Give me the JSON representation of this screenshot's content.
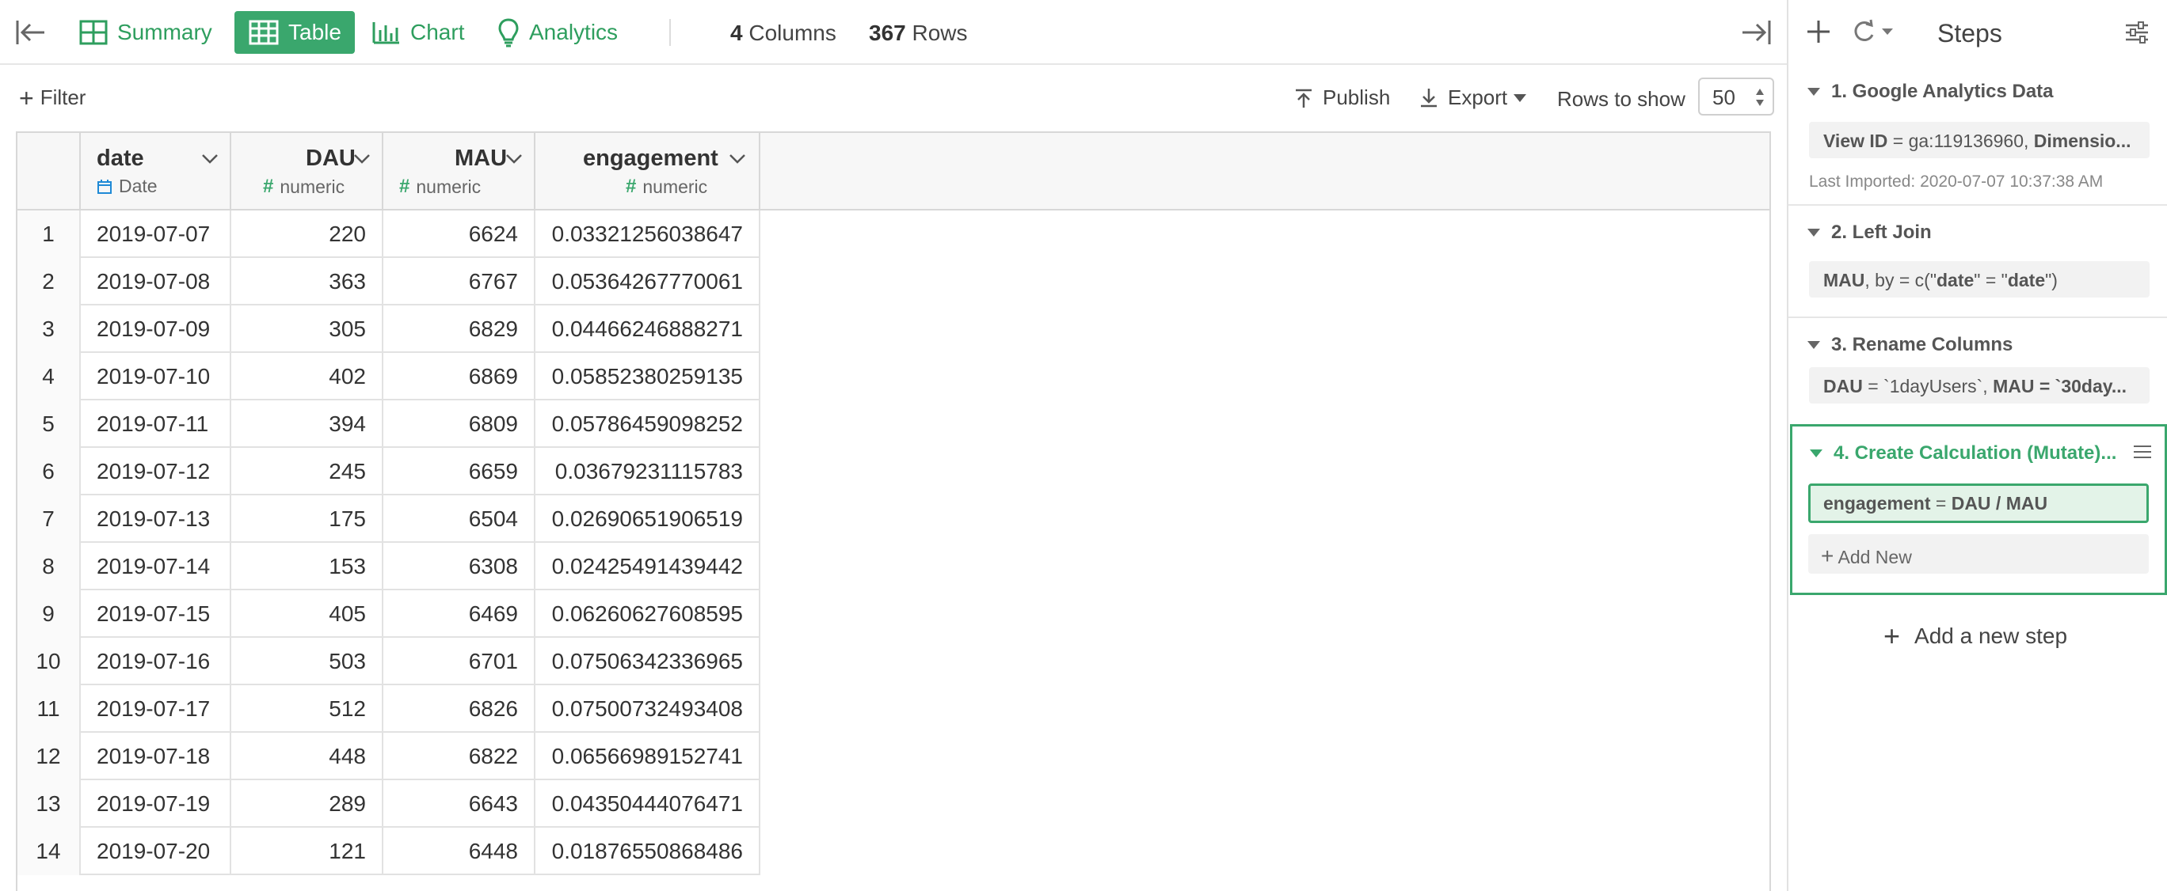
{
  "toolbar": {
    "tabs": [
      {
        "label": "Summary",
        "icon": "grid-icon"
      },
      {
        "label": "Table",
        "icon": "table-icon",
        "active": true
      },
      {
        "label": "Chart",
        "icon": "bar-chart-icon"
      },
      {
        "label": "Analytics",
        "icon": "lightbulb-icon"
      }
    ],
    "columns_count": "4",
    "columns_label": "Columns",
    "rows_count": "367",
    "rows_label": "Rows",
    "accent_color": "#3aa76d"
  },
  "filterbar": {
    "filter_label": "Filter",
    "publish_label": "Publish",
    "export_label": "Export",
    "rows_to_show_label": "Rows to show",
    "rows_to_show_value": "50"
  },
  "table": {
    "columns": [
      {
        "name": "date",
        "type": "Date"
      },
      {
        "name": "DAU",
        "type": "numeric"
      },
      {
        "name": "MAU",
        "type": "numeric"
      },
      {
        "name": "engagement",
        "type": "numeric"
      }
    ],
    "rows": [
      [
        "1",
        "2019-07-07",
        "220",
        "6624",
        "0.03321256038647"
      ],
      [
        "2",
        "2019-07-08",
        "363",
        "6767",
        "0.05364267770061"
      ],
      [
        "3",
        "2019-07-09",
        "305",
        "6829",
        "0.04466246888271"
      ],
      [
        "4",
        "2019-07-10",
        "402",
        "6869",
        "0.05852380259135"
      ],
      [
        "5",
        "2019-07-11",
        "394",
        "6809",
        "0.05786459098252"
      ],
      [
        "6",
        "2019-07-12",
        "245",
        "6659",
        "0.03679231115783"
      ],
      [
        "7",
        "2019-07-13",
        "175",
        "6504",
        "0.02690651906519"
      ],
      [
        "8",
        "2019-07-14",
        "153",
        "6308",
        "0.02425491439442"
      ],
      [
        "9",
        "2019-07-15",
        "405",
        "6469",
        "0.06260627608595"
      ],
      [
        "10",
        "2019-07-16",
        "503",
        "6701",
        "0.07506342336965"
      ],
      [
        "11",
        "2019-07-17",
        "512",
        "6826",
        "0.07500732493408"
      ],
      [
        "12",
        "2019-07-18",
        "448",
        "6822",
        "0.06566989152741"
      ],
      [
        "13",
        "2019-07-19",
        "289",
        "6643",
        "0.04350444076471"
      ],
      [
        "14",
        "2019-07-20",
        "121",
        "6448",
        "0.01876550868486"
      ]
    ]
  },
  "steps": {
    "title": "Steps",
    "items": [
      {
        "title": "1. Google Analytics Data",
        "detail_key": "View ID",
        "detail_op": " = ga:119136960, ",
        "detail_rest": "Dimensio...",
        "meta": "Last Imported: 2020-07-07 10:37:38 AM"
      },
      {
        "title": "2. Left Join",
        "detail_key": "MAU",
        "detail_op": ", by = c(\"",
        "detail_rest": "date"
      },
      {
        "title": "3. Rename Columns",
        "detail_key": "DAU",
        "detail_op": " = `1dayUsers`, ",
        "detail_rest": "MAU = `30day..."
      },
      {
        "title": "4. Create Calculation (Mutate)...",
        "detail_key": "engagement",
        "detail_op": " = ",
        "detail_rest": "DAU / MAU",
        "add_new": "Add New"
      }
    ],
    "add_step_label": "Add a new step"
  }
}
